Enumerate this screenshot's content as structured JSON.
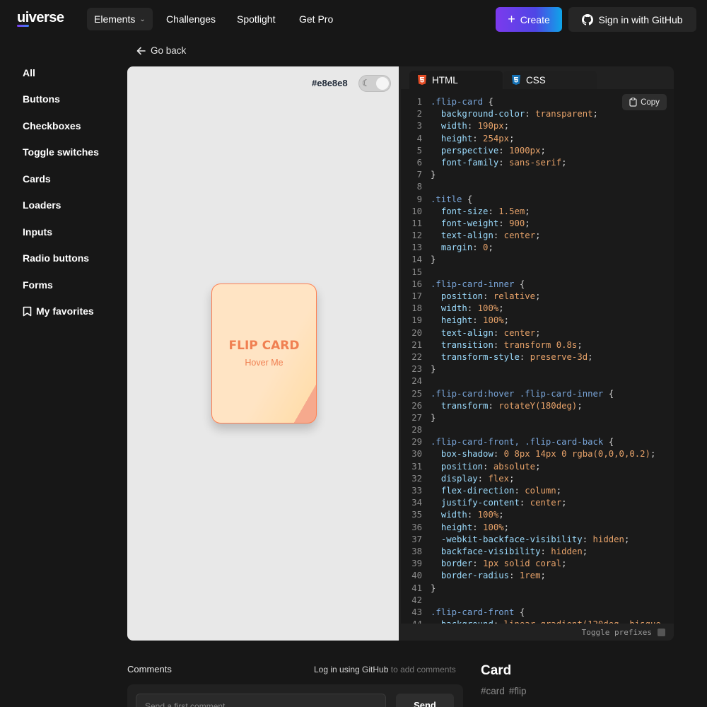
{
  "nav": {
    "logo_prefix": "ui",
    "logo_suffix": "verse",
    "elements_label": "Elements",
    "links": [
      "Challenges",
      "Spotlight",
      "Get Pro"
    ],
    "create_label": "Create",
    "github_label": "Sign in with GitHub"
  },
  "sidebar": {
    "items": [
      "All",
      "Buttons",
      "Checkboxes",
      "Toggle switches",
      "Cards",
      "Loaders",
      "Inputs",
      "Radio buttons",
      "Forms",
      "My favorites"
    ]
  },
  "goback_label": "Go back",
  "preview": {
    "bg_hex": "#e8e8e8",
    "card_title": "FLIP CARD",
    "card_subtitle": "Hover Me"
  },
  "code": {
    "tabs": [
      "HTML",
      "CSS"
    ],
    "copy_label": "Copy",
    "toggle_prefixes_label": "Toggle prefixes",
    "lines": [
      ".flip-card {",
      "  background-color: transparent;",
      "  width: 190px;",
      "  height: 254px;",
      "  perspective: 1000px;",
      "  font-family: sans-serif;",
      "}",
      "",
      ".title {",
      "  font-size: 1.5em;",
      "  font-weight: 900;",
      "  text-align: center;",
      "  margin: 0;",
      "}",
      "",
      ".flip-card-inner {",
      "  position: relative;",
      "  width: 100%;",
      "  height: 100%;",
      "  text-align: center;",
      "  transition: transform 0.8s;",
      "  transform-style: preserve-3d;",
      "}",
      "",
      ".flip-card:hover .flip-card-inner {",
      "  transform: rotateY(180deg);",
      "}",
      "",
      ".flip-card-front, .flip-card-back {",
      "  box-shadow: 0 8px 14px 0 rgba(0,0,0,0.2);",
      "  position: absolute;",
      "  display: flex;",
      "  flex-direction: column;",
      "  justify-content: center;",
      "  width: 100%;",
      "  height: 100%;",
      "  -webkit-backface-visibility: hidden;",
      "  backface-visibility: hidden;",
      "  border: 1px solid coral;",
      "  border-radius: 1rem;",
      "}",
      "",
      ".flip-card-front {",
      "  background: linear-gradient(120deg, bisque"
    ]
  },
  "comments": {
    "label": "Comments",
    "login_link": "Log in using GitHub",
    "login_suffix": " to add comments",
    "input_placeholder": "Send a first comment...",
    "send_label": "Send"
  },
  "details": {
    "title": "Card",
    "tags": [
      "#card",
      "#flip"
    ]
  },
  "colors": {
    "accent_purple": "#7c3aed",
    "accent_blue": "#0ea5e9",
    "card_border": "coral",
    "card_text": "#f08052"
  }
}
